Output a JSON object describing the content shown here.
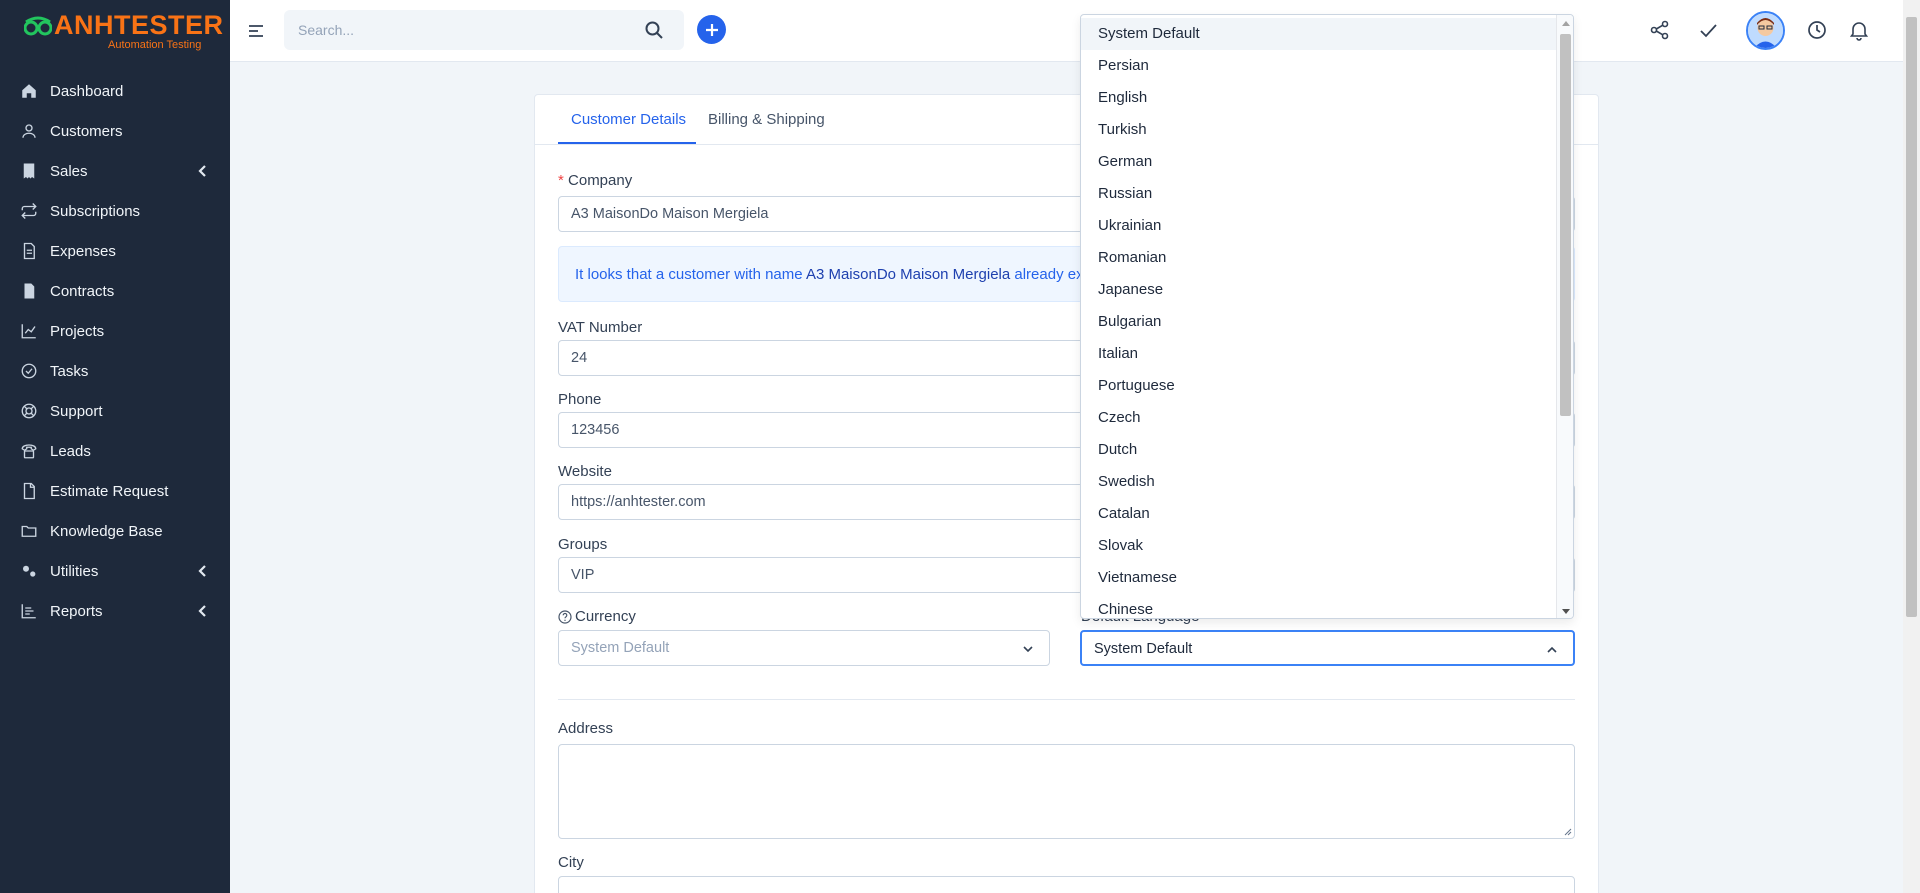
{
  "brand": {
    "name": "ANHTESTER",
    "tagline": "Automation Testing",
    "accent": "#f97316"
  },
  "sidebar": {
    "items": [
      {
        "label": "Dashboard",
        "icon": "home-icon"
      },
      {
        "label": "Customers",
        "icon": "user-icon"
      },
      {
        "label": "Sales",
        "icon": "receipt-icon",
        "has_submenu": true
      },
      {
        "label": "Subscriptions",
        "icon": "repeat-icon"
      },
      {
        "label": "Expenses",
        "icon": "document-icon"
      },
      {
        "label": "Contracts",
        "icon": "contract-icon"
      },
      {
        "label": "Projects",
        "icon": "chart-icon"
      },
      {
        "label": "Tasks",
        "icon": "check-circle-icon"
      },
      {
        "label": "Support",
        "icon": "lifebuoy-icon"
      },
      {
        "label": "Leads",
        "icon": "phone-icon"
      },
      {
        "label": "Estimate Request",
        "icon": "file-icon"
      },
      {
        "label": "Knowledge Base",
        "icon": "folder-icon"
      },
      {
        "label": "Utilities",
        "icon": "cogs-icon",
        "has_submenu": true
      },
      {
        "label": "Reports",
        "icon": "bar-chart-icon",
        "has_submenu": true
      }
    ]
  },
  "header": {
    "search_placeholder": "Search..."
  },
  "tabs": [
    {
      "label": "Customer Details",
      "active": true
    },
    {
      "label": "Billing & Shipping",
      "active": false
    }
  ],
  "form": {
    "company": {
      "label": "Company",
      "required_mark": "*",
      "value": "A3 MaisonDo Maison Mergiela"
    },
    "alert": {
      "prefix": "It looks that a customer with name ",
      "name": "A3 MaisonDo Maison Mergiela",
      "suffix": " already exist"
    },
    "vat": {
      "label": "VAT Number",
      "value": "24"
    },
    "phone": {
      "label": "Phone",
      "value": "123456"
    },
    "website": {
      "label": "Website",
      "value": "https://anhtester.com"
    },
    "groups": {
      "label": "Groups",
      "value": "VIP"
    },
    "currency": {
      "label": "Currency",
      "value": "System Default"
    },
    "default_language": {
      "label": "Default Language",
      "value": "System Default"
    },
    "address": {
      "label": "Address"
    },
    "city": {
      "label": "City"
    }
  },
  "language_dropdown": {
    "options": [
      "System Default",
      "Persian",
      "English",
      "Turkish",
      "German",
      "Russian",
      "Ukrainian",
      "Romanian",
      "Japanese",
      "Bulgarian",
      "Italian",
      "Portuguese",
      "Czech",
      "Dutch",
      "Swedish",
      "Catalan",
      "Slovak",
      "Vietnamese",
      "Chinese"
    ],
    "selected": "System Default"
  },
  "colors": {
    "sidebar_bg": "#1e293b",
    "primary": "#2563eb"
  }
}
